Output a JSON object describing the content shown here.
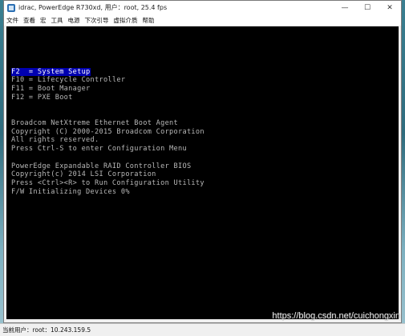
{
  "window": {
    "title": "idrac, PowerEdge R730xd, 用户：root, 25.4 fps"
  },
  "window_controls": {
    "minimize": "—",
    "maximize": "☐",
    "close": "✕"
  },
  "menu": {
    "items": [
      "文件",
      "查看",
      "宏",
      "工具",
      "电源",
      "下次引导",
      "虚拟介质",
      "帮助"
    ]
  },
  "console": {
    "lines": [
      {
        "text": "F2  = System Setup",
        "selected": true
      },
      {
        "text": "F10 = Lifecycle Controller",
        "selected": false
      },
      {
        "text": "F11 = Boot Manager",
        "selected": false
      },
      {
        "text": "F12 = PXE Boot",
        "selected": false
      },
      {
        "text": "Broadcom NetXtreme Ethernet Boot Agent",
        "selected": false
      },
      {
        "text": "Copyright (C) 2000-2015 Broadcom Corporation",
        "selected": false
      },
      {
        "text": "All rights reserved.",
        "selected": false
      },
      {
        "text": "Press Ctrl-S to enter Configuration Menu",
        "selected": false
      },
      {
        "text": "PowerEdge Expandable RAID Controller BIOS",
        "selected": false
      },
      {
        "text": "Copyright(c) 2014 LSI Corporation",
        "selected": false
      },
      {
        "text": "Press <Ctrl><R> to Run Configuration Utility",
        "selected": false
      },
      {
        "text": "F/W Initializing Devices 0%",
        "selected": false
      }
    ]
  },
  "status": {
    "text": "当前用户：root：10.243.159.5"
  },
  "watermark": {
    "text": "https://blog.csdn.net/cuichongxin"
  }
}
